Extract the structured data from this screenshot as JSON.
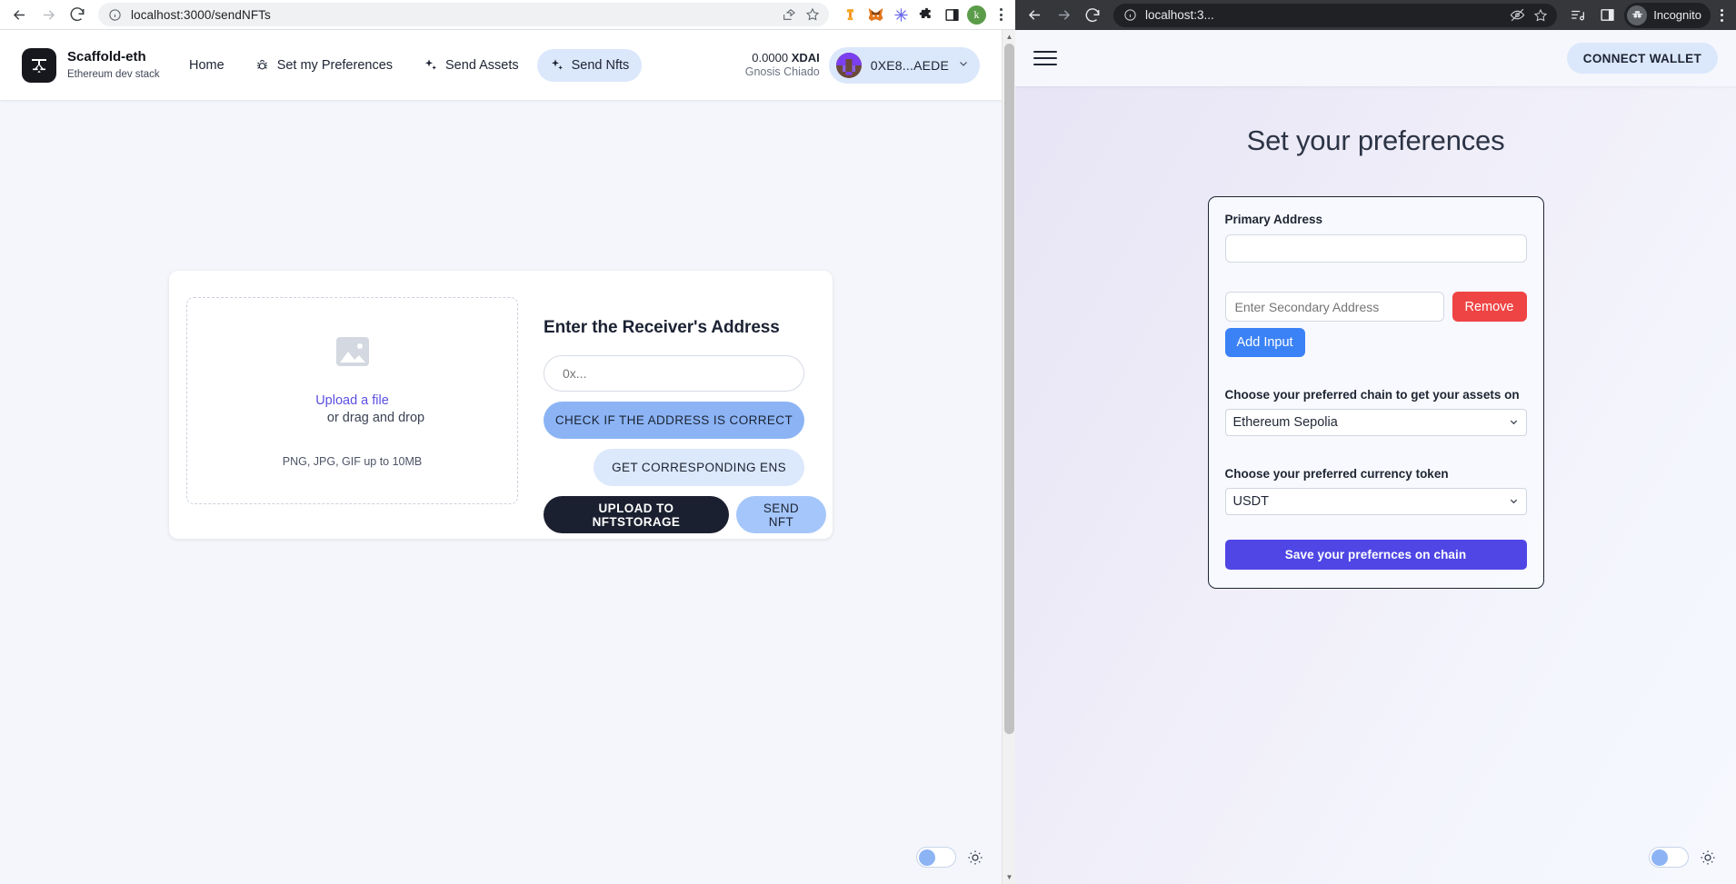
{
  "window1": {
    "browser": {
      "back_icon": "arrow-left-icon",
      "forward_icon": "arrow-right-icon",
      "reload_icon": "reload-icon",
      "site_info_icon": "info-circle-icon",
      "url": "localhost:3000/sendNFTs",
      "share_icon": "share-icon",
      "bookmark_icon": "star-icon",
      "extensions": [
        "rainbow-extension-icon",
        "metamask-fox-icon",
        "snowflake-extension-icon",
        "puzzle-extensions-icon",
        "side-panel-icon"
      ],
      "profile_initial": "k",
      "menu_icon": "kebab-menu-icon"
    },
    "app": {
      "brand_name": "Scaffold-eth",
      "brand_subtitle": "Ethereum dev stack",
      "logo_icon": "scaffold-eth-logo-icon",
      "nav": [
        {
          "label": "Home",
          "icon": "",
          "active": false
        },
        {
          "label": "Set my Preferences",
          "icon": "bug-icon",
          "active": false
        },
        {
          "label": "Send Assets",
          "icon": "sparkles-icon",
          "active": false
        },
        {
          "label": "Send Nfts",
          "icon": "sparkles-icon",
          "active": true
        }
      ],
      "balance": "0.0000",
      "balance_symbol": "XDAI",
      "network": "Gnosis Chiado",
      "account_address": "0XE8...AEDE",
      "account_chevron_icon": "chevron-down-icon",
      "avatar_icon": "blockie-avatar"
    },
    "card": {
      "dropzone": {
        "image_icon": "image-placeholder-icon",
        "upload_link": "Upload a file",
        "drag_text": "or drag and drop",
        "hint": "PNG, JPG, GIF up to 10MB"
      },
      "title": "Enter the Receiver's Address",
      "address_placeholder": "0x...",
      "address_value": "",
      "check_button": "CHECK IF THE ADDRESS IS CORRECT",
      "ens_button": "GET CORRESPONDING ENS",
      "upload_button": "UPLOAD TO NFTSTORAGE",
      "send_button": "SEND NFT"
    },
    "theme": {
      "toggle_icon": "theme-toggle",
      "sun_icon": "sun-icon"
    },
    "scrollbar": {
      "up_icon": "scroll-up-arrow",
      "down_icon": "scroll-down-arrow"
    }
  },
  "window2": {
    "browser": {
      "back_icon": "arrow-left-icon",
      "forward_icon": "arrow-right-icon",
      "reload_icon": "reload-icon",
      "site_info_icon": "info-circle-icon",
      "url": "localhost:3...",
      "eye_off_icon": "eye-off-icon",
      "bookmark_icon": "star-icon",
      "media_icon": "media-list-icon",
      "side_panel_icon": "side-panel-icon",
      "incognito_label": "Incognito",
      "incognito_icon": "incognito-hat-icon",
      "menu_icon": "kebab-menu-icon"
    },
    "app": {
      "menu_icon": "hamburger-menu-icon",
      "connect_wallet": "CONNECT WALLET",
      "page_title": "Set your preferences",
      "primary_address_label": "Primary Address",
      "primary_address_value": "",
      "secondary_address_placeholder": "Enter Secondary Address",
      "secondary_address_value": "",
      "remove_button": "Remove",
      "add_input_button": "Add Input",
      "chain_label": "Choose your preferred chain to get your assets on",
      "chain_value": "Ethereum Sepolia",
      "chain_options": [
        "Ethereum Sepolia"
      ],
      "currency_label": "Choose your preferred currency token",
      "currency_value": "USDT",
      "currency_options": [
        "USDT"
      ],
      "save_button": "Save your prefernces on chain",
      "chevron_icon": "chevron-down-icon"
    },
    "theme": {
      "toggle_icon": "theme-toggle",
      "sun_icon": "sun-icon"
    }
  },
  "colors": {
    "accent_blue": "#8cb4f5",
    "accent_light_blue": "#dce8fb",
    "dark": "#1b2030",
    "indigo": "#4f46e5",
    "red": "#ef4444",
    "blue": "#3b82f6",
    "purple_link": "#5b4fe0"
  }
}
